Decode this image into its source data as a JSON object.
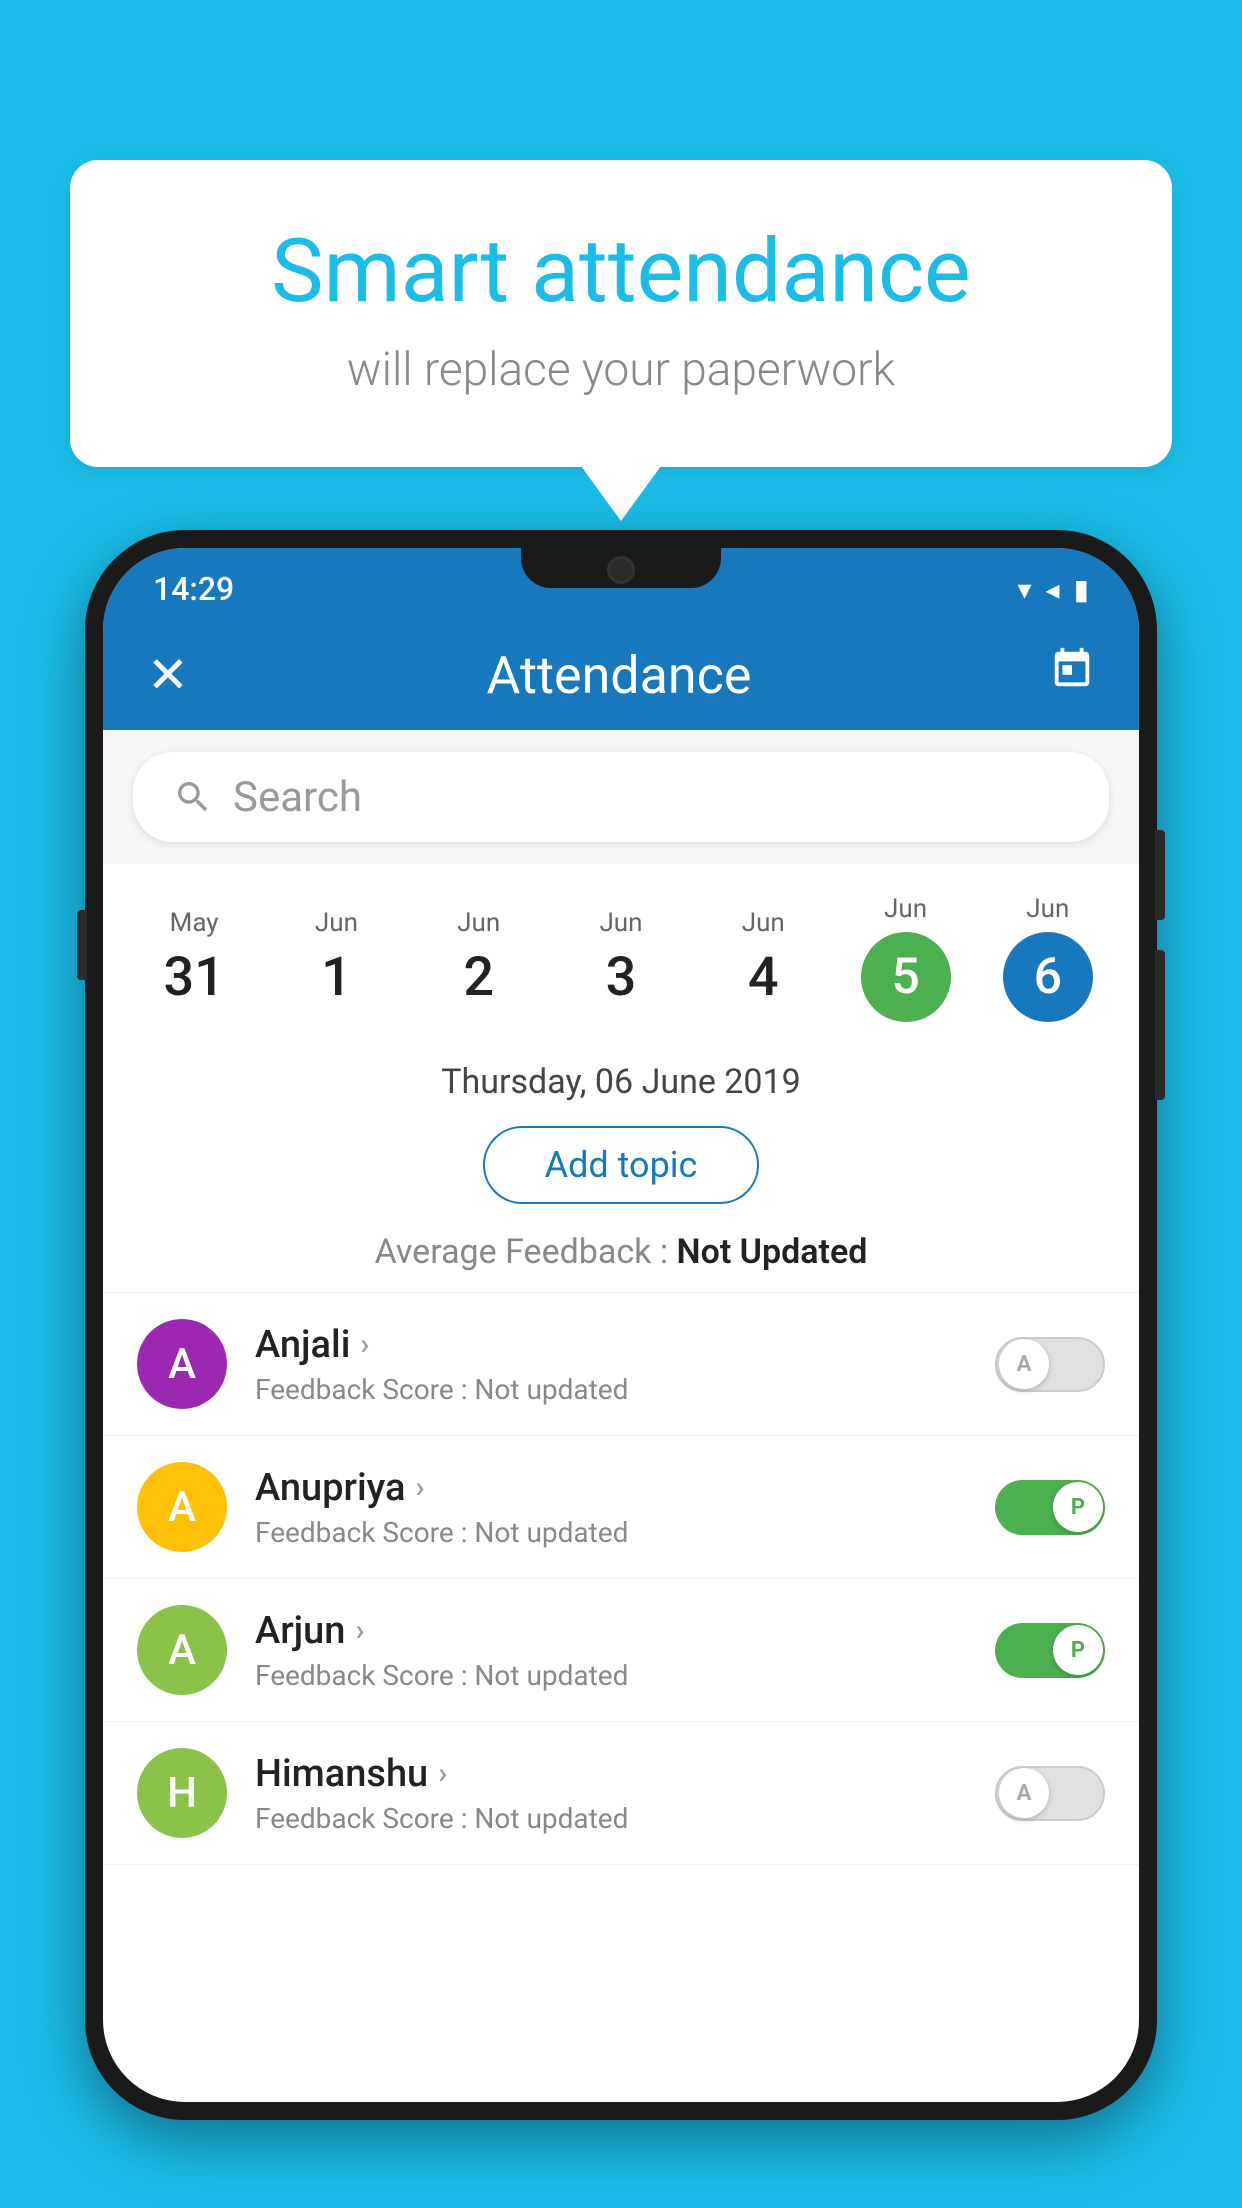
{
  "bubble": {
    "title": "Smart attendance",
    "subtitle": "will replace your paperwork"
  },
  "statusBar": {
    "time": "14:29",
    "wifi_icon": "▼",
    "signal_icon": "▲",
    "battery_icon": "▮"
  },
  "appBar": {
    "close_label": "✕",
    "title": "Attendance",
    "calendar_icon": "📅"
  },
  "search": {
    "placeholder": "Search"
  },
  "calendar": {
    "days": [
      {
        "month": "May",
        "date": "31",
        "selected": ""
      },
      {
        "month": "Jun",
        "date": "1",
        "selected": ""
      },
      {
        "month": "Jun",
        "date": "2",
        "selected": ""
      },
      {
        "month": "Jun",
        "date": "3",
        "selected": ""
      },
      {
        "month": "Jun",
        "date": "4",
        "selected": ""
      },
      {
        "month": "Jun",
        "date": "5",
        "selected": "green"
      },
      {
        "month": "Jun",
        "date": "6",
        "selected": "blue"
      }
    ]
  },
  "selectedDate": {
    "display": "Thursday, 06 June 2019"
  },
  "addTopicBtn": {
    "label": "Add topic"
  },
  "averageFeedback": {
    "label": "Average Feedback : ",
    "value": "Not Updated"
  },
  "students": [
    {
      "name": "Anjali",
      "avatarBg": "#9C27B0",
      "avatarLetter": "A",
      "feedback": "Feedback Score : Not updated",
      "toggleState": "off",
      "toggleLabel": "A"
    },
    {
      "name": "Anupriya",
      "avatarBg": "#FFC107",
      "avatarLetter": "A",
      "feedback": "Feedback Score : Not updated",
      "toggleState": "on",
      "toggleLabel": "P"
    },
    {
      "name": "Arjun",
      "avatarBg": "#8BC34A",
      "avatarLetter": "A",
      "feedback": "Feedback Score : Not updated",
      "toggleState": "on",
      "toggleLabel": "P"
    },
    {
      "name": "Himanshu",
      "avatarBg": "#8BC34A",
      "avatarLetter": "H",
      "feedback": "Feedback Score : Not updated",
      "toggleState": "off",
      "toggleLabel": "A"
    }
  ]
}
